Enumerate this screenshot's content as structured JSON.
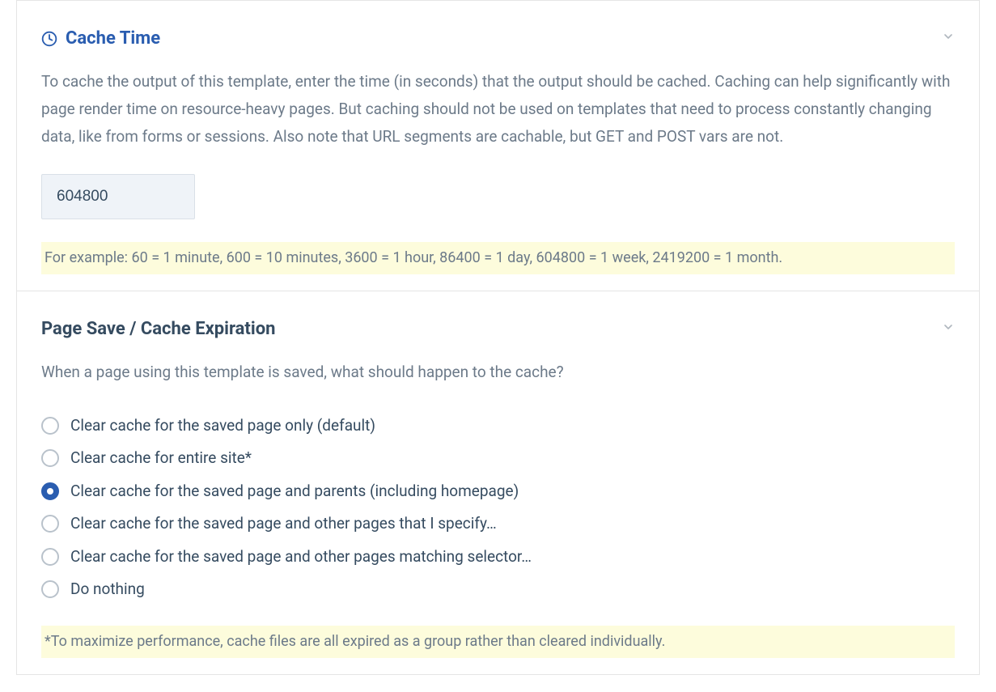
{
  "cacheTime": {
    "title": "Cache Time",
    "description": "To cache the output of this template, enter the time (in seconds) that the output should be cached. Caching can help significantly with page render time on resource-heavy pages. But caching should not be used on templates that need to process constantly changing data, like from forms or sessions. Also note that URL segments are cachable, but GET and POST vars are not.",
    "value": "604800",
    "note": "For example: 60 = 1 minute, 600 = 10 minutes, 3600 = 1 hour, 86400 = 1 day, 604800 = 1 week, 2419200 = 1 month."
  },
  "cacheExpiration": {
    "title": "Page Save / Cache Expiration",
    "description": "When a page using this template is saved, what should happen to the cache?",
    "options": [
      "Clear cache for the saved page only (default)",
      "Clear cache for entire site*",
      "Clear cache for the saved page and parents (including homepage)",
      "Clear cache for the saved page and other pages that I specify…",
      "Clear cache for the saved page and other pages matching selector…",
      "Do nothing"
    ],
    "selectedIndex": 2,
    "note": "*To maximize performance, cache files are all expired as a group rather than cleared individually."
  }
}
